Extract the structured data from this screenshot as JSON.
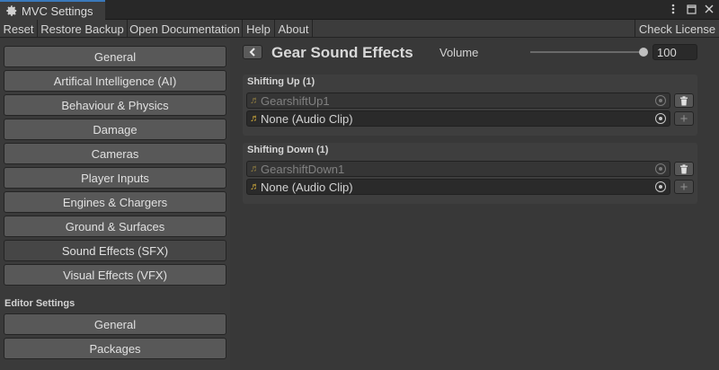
{
  "window": {
    "tab_title": "MVC Settings",
    "tab_icon": "gear-icon",
    "controls": [
      "more-icon",
      "maximize-icon",
      "close-icon"
    ]
  },
  "toolbar": {
    "reset_label": "Reset",
    "restore_backup_label": "Restore Backup",
    "open_documentation_label": "Open Documentation",
    "help_label": "Help",
    "about_label": "About",
    "check_license_label": "Check License"
  },
  "sidebar": {
    "items": [
      {
        "label": "General",
        "active": false
      },
      {
        "label": "Artifical Intelligence (AI)",
        "active": false
      },
      {
        "label": "Behaviour & Physics",
        "active": false
      },
      {
        "label": "Damage",
        "active": false
      },
      {
        "label": "Cameras",
        "active": false
      },
      {
        "label": "Player Inputs",
        "active": false
      },
      {
        "label": "Engines & Chargers",
        "active": false
      },
      {
        "label": "Ground & Surfaces",
        "active": false
      },
      {
        "label": "Sound Effects (SFX)",
        "active": true
      },
      {
        "label": "Visual Effects (VFX)",
        "active": false
      }
    ],
    "editor_section_title": "Editor Settings",
    "editor_items": [
      {
        "label": "General"
      },
      {
        "label": "Packages"
      }
    ]
  },
  "main": {
    "title": "Gear Sound Effects",
    "volume": {
      "label": "Volume",
      "value": "100",
      "slider_fraction": 1.0
    },
    "groups": [
      {
        "title": "Shifting Up (1)",
        "clips": [
          {
            "name": "GearshiftUp1",
            "disabled": true,
            "action": "delete-icon"
          },
          {
            "name": "None (Audio Clip)",
            "disabled": false,
            "action": "plus-icon"
          }
        ]
      },
      {
        "title": "Shifting Down (1)",
        "clips": [
          {
            "name": "GearshiftDown1",
            "disabled": true,
            "action": "delete-icon"
          },
          {
            "name": "None (Audio Clip)",
            "disabled": false,
            "action": "plus-icon"
          }
        ]
      }
    ]
  },
  "colors": {
    "accent_tab": "#3a79bb",
    "audio_note": "#c8a43a",
    "background": "#383838"
  }
}
